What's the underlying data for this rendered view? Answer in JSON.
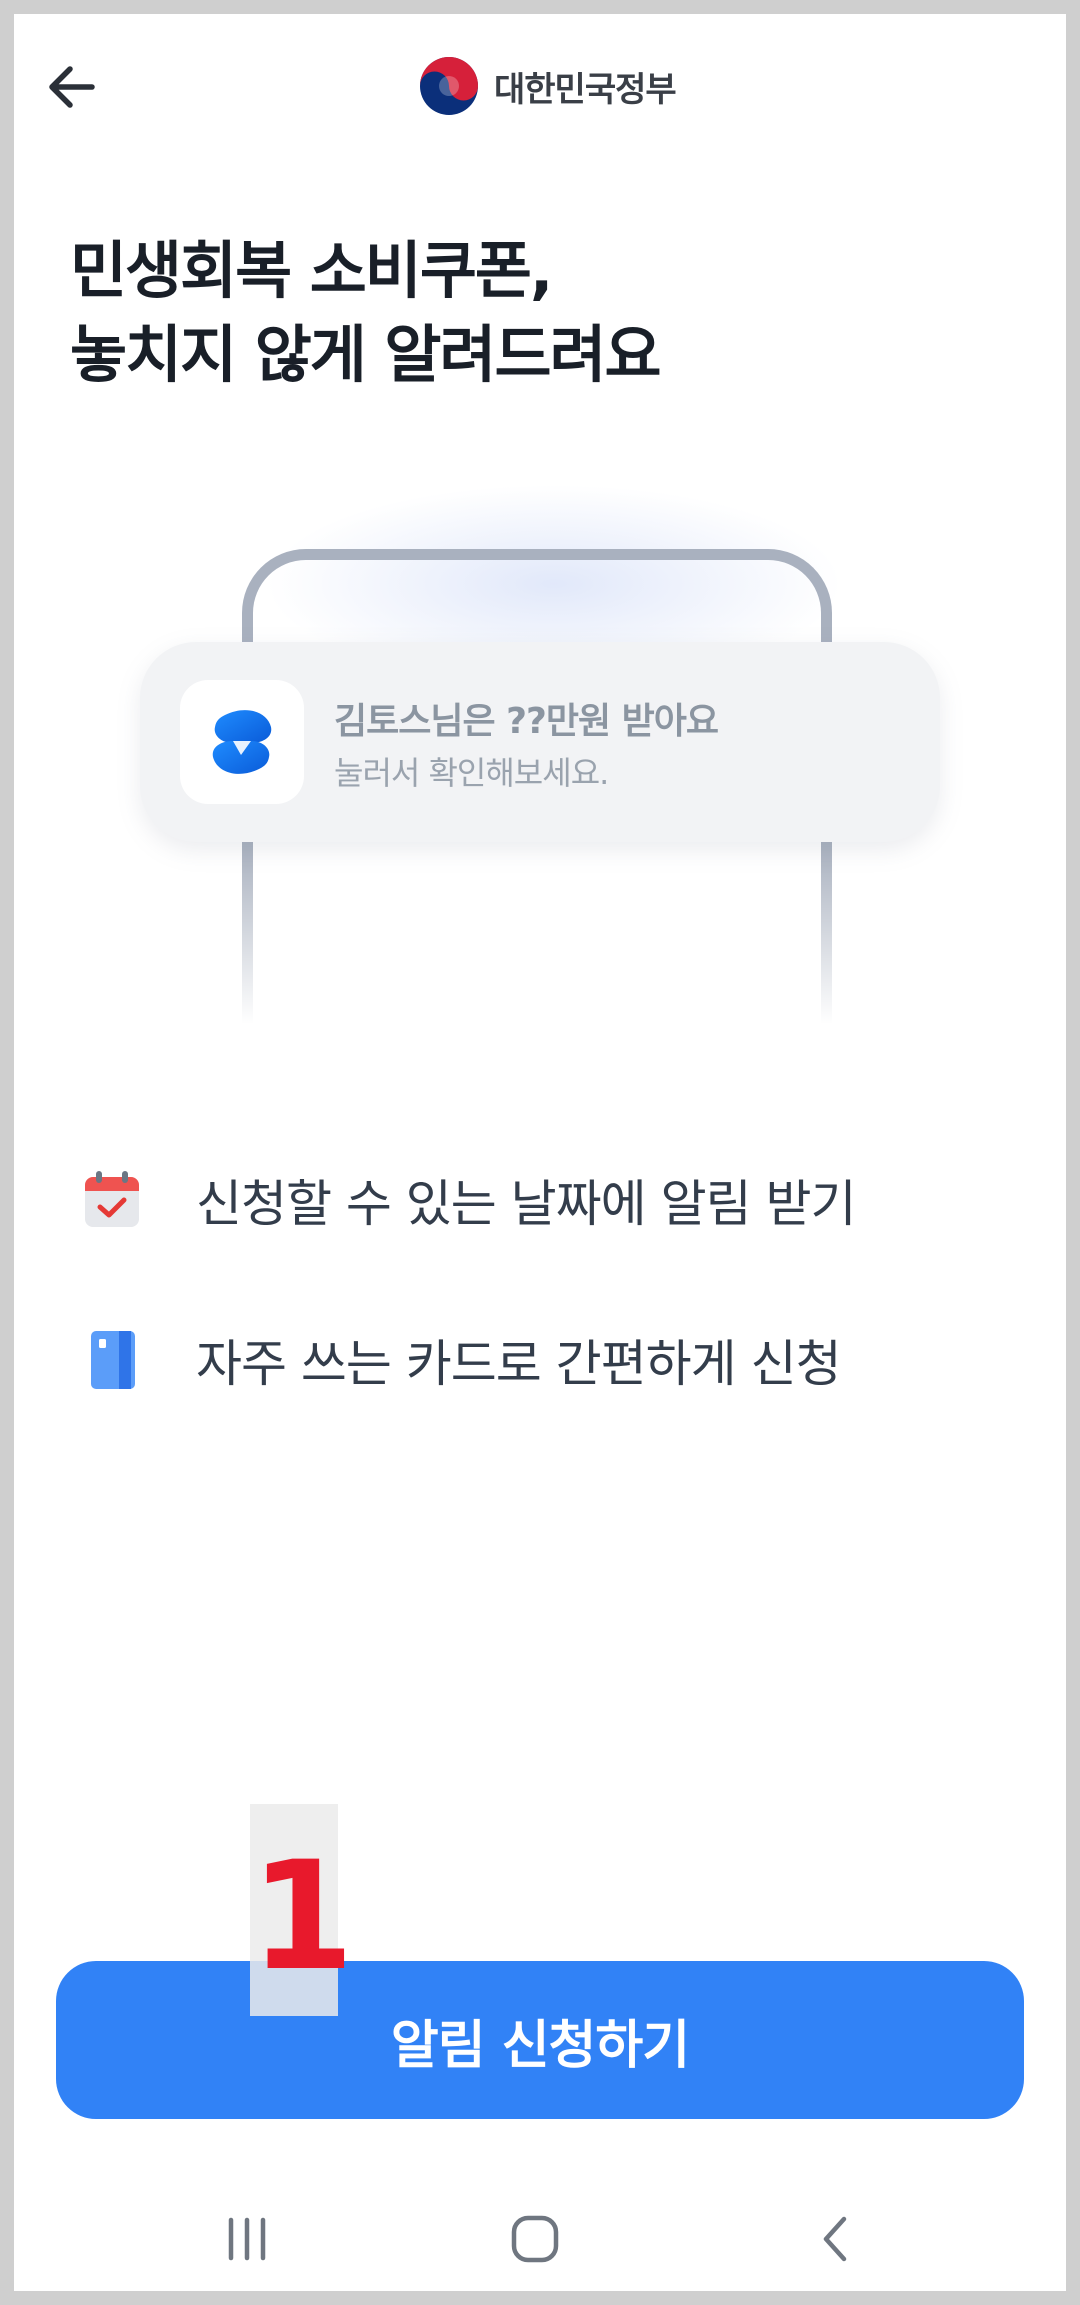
{
  "header": {
    "back_icon": "arrow-left-icon",
    "brand_emblem": "taegeuk-emblem",
    "brand_name": "대한민국정부"
  },
  "headline": {
    "line1": "민생회복 소비쿠폰,",
    "line2": "놓치지 않게 알려드려요"
  },
  "illustration": {
    "app_icon": "toss-logo-icon",
    "notification_title": "김토스님은 ??만원 받아요",
    "notification_subtitle": "눌러서 확인해보세요."
  },
  "features": [
    {
      "icon": "calendar-check-icon",
      "label": "신청할 수 있는 날짜에 알림 받기"
    },
    {
      "icon": "card-icon",
      "label": "자주 쓰는 카드로 간편하게 신청"
    }
  ],
  "marker_label": "1",
  "cta": {
    "label": "알림 신청하기"
  },
  "nav": {
    "recents_icon": "recents-icon",
    "home_icon": "home-icon",
    "back_icon": "nav-back-icon"
  },
  "colors": {
    "primary": "#3182f6",
    "text_dark": "#191f28",
    "marker_red": "#e8192c",
    "background": "#ffffff"
  }
}
